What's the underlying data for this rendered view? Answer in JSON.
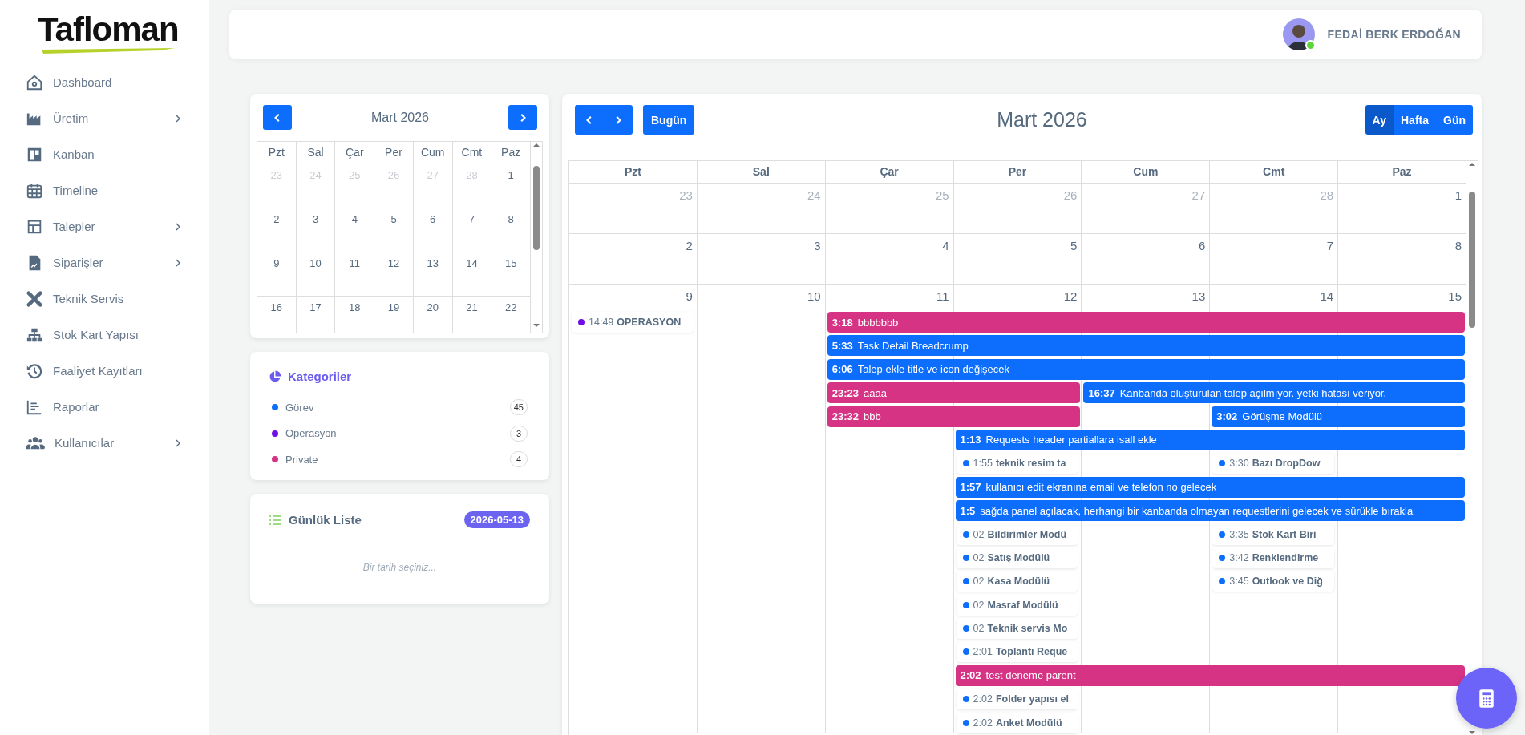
{
  "sidebar": {
    "logo": "Tafloman",
    "items": [
      {
        "label": "Dashboard",
        "has_submenu": false
      },
      {
        "label": "Üretim",
        "has_submenu": true
      },
      {
        "label": "Kanban",
        "has_submenu": false
      },
      {
        "label": "Timeline",
        "has_submenu": false
      },
      {
        "label": "Talepler",
        "has_submenu": true
      },
      {
        "label": "Siparişler",
        "has_submenu": true
      },
      {
        "label": "Teknik Servis",
        "has_submenu": false
      },
      {
        "label": "Stok Kart Yapısı",
        "has_submenu": false
      },
      {
        "label": "Faaliyet Kayıtları",
        "has_submenu": false
      },
      {
        "label": "Raporlar",
        "has_submenu": false
      },
      {
        "label": "Kullanıcılar",
        "has_submenu": true
      }
    ]
  },
  "header": {
    "user_name": "FEDAİ BERK ERDOĞAN",
    "online": true
  },
  "mini_calendar": {
    "title": "Mart 2026",
    "weekdays": [
      "Pzt",
      "Sal",
      "Çar",
      "Per",
      "Cum",
      "Cmt",
      "Paz"
    ],
    "weeks": [
      [
        {
          "day": "23",
          "muted": true
        },
        {
          "day": "24",
          "muted": true
        },
        {
          "day": "25",
          "muted": true
        },
        {
          "day": "26",
          "muted": true
        },
        {
          "day": "27",
          "muted": true
        },
        {
          "day": "28",
          "muted": true
        },
        {
          "day": "1",
          "muted": false
        }
      ],
      [
        {
          "day": "2",
          "muted": false
        },
        {
          "day": "3",
          "muted": false
        },
        {
          "day": "4",
          "muted": false
        },
        {
          "day": "5",
          "muted": false
        },
        {
          "day": "6",
          "muted": false
        },
        {
          "day": "7",
          "muted": false
        },
        {
          "day": "8",
          "muted": false
        }
      ],
      [
        {
          "day": "9",
          "muted": false
        },
        {
          "day": "10",
          "muted": false
        },
        {
          "day": "11",
          "muted": false
        },
        {
          "day": "12",
          "muted": false
        },
        {
          "day": "13",
          "muted": false
        },
        {
          "day": "14",
          "muted": false
        },
        {
          "day": "15",
          "muted": false
        }
      ],
      [
        {
          "day": "16",
          "muted": false
        },
        {
          "day": "17",
          "muted": false
        },
        {
          "day": "18",
          "muted": false
        },
        {
          "day": "19",
          "muted": false
        },
        {
          "day": "20",
          "muted": false
        },
        {
          "day": "21",
          "muted": false
        },
        {
          "day": "22",
          "muted": false
        }
      ]
    ]
  },
  "categories": {
    "title": "Kategoriler",
    "items": [
      {
        "label": "Görev",
        "count": "45",
        "color": "#0d6efd"
      },
      {
        "label": "Operasyon",
        "count": "3",
        "color": "#6f0fe6"
      },
      {
        "label": "Private",
        "count": "4",
        "color": "#d63384"
      }
    ]
  },
  "daily_list": {
    "title": "Günlük Liste",
    "date": "2026-05-13",
    "empty_text": "Bir tarih seçiniz..."
  },
  "calendar": {
    "title": "Mart 2026",
    "today_button": "Bugün",
    "views": [
      {
        "label": "Ay",
        "selected": true
      },
      {
        "label": "Hafta",
        "selected": false
      },
      {
        "label": "Gün",
        "selected": false
      }
    ],
    "weekdays": [
      "Pzt",
      "Sal",
      "Çar",
      "Per",
      "Cum",
      "Cmt",
      "Paz"
    ],
    "weeks": [
      {
        "days": [
          {
            "day": "23",
            "muted": true
          },
          {
            "day": "24",
            "muted": true
          },
          {
            "day": "25",
            "muted": true
          },
          {
            "day": "26",
            "muted": true
          },
          {
            "day": "27",
            "muted": true
          },
          {
            "day": "28",
            "muted": true
          },
          {
            "day": "1",
            "muted": false
          }
        ]
      },
      {
        "days": [
          {
            "day": "2",
            "muted": false
          },
          {
            "day": "3",
            "muted": false
          },
          {
            "day": "4",
            "muted": false
          },
          {
            "day": "5",
            "muted": false
          },
          {
            "day": "6",
            "muted": false
          },
          {
            "day": "7",
            "muted": false
          },
          {
            "day": "8",
            "muted": false
          }
        ]
      },
      {
        "days": [
          {
            "day": "9",
            "muted": false
          },
          {
            "day": "10",
            "muted": false
          },
          {
            "day": "11",
            "muted": false
          },
          {
            "day": "12",
            "muted": false
          },
          {
            "day": "13",
            "muted": false
          },
          {
            "day": "14",
            "muted": false
          },
          {
            "day": "15",
            "muted": false
          }
        ],
        "lanes": [
          [
            {
              "kind": "dot",
              "time": "14:49",
              "title": "OPERASYON",
              "color": "#6f0fe6"
            },
            {
              "kind": "empty"
            },
            {
              "kind": "bar",
              "time": "3:18",
              "title": "bbbbbbb",
              "color": "#d63384"
            },
            {
              "kind": "more"
            },
            {
              "kind": "more"
            },
            {
              "kind": "more"
            },
            {
              "kind": "more"
            }
          ],
          [
            {
              "kind": "empty"
            },
            {
              "kind": "empty"
            },
            {
              "kind": "bar",
              "time": "5:33",
              "title": "Task Detail Breadcrump",
              "color": "#0d6efd"
            },
            {
              "kind": "more"
            },
            {
              "kind": "more"
            },
            {
              "kind": "more"
            },
            {
              "kind": "more"
            }
          ],
          [
            {
              "kind": "empty"
            },
            {
              "kind": "empty"
            },
            {
              "kind": "bar",
              "time": "6:06",
              "title": "Talep ekle title ve icon değişecek",
              "color": "#0d6efd"
            },
            {
              "kind": "more"
            },
            {
              "kind": "more"
            },
            {
              "kind": "more"
            },
            {
              "kind": "more"
            }
          ],
          [
            {
              "kind": "empty"
            },
            {
              "kind": "empty"
            },
            {
              "kind": "bar",
              "time": "23:23",
              "title": "aaaa",
              "color": "#d63384"
            },
            {
              "kind": "more"
            },
            {
              "kind": "bar",
              "time": "16:37",
              "title": "Kanbanda oluşturulan talep açılmıyor. yetki hatası veriyor.",
              "color": "#0d6efd"
            },
            {
              "kind": "more"
            },
            {
              "kind": "more"
            }
          ],
          [
            {
              "kind": "empty"
            },
            {
              "kind": "empty"
            },
            {
              "kind": "bar",
              "time": "23:32",
              "title": "bbb",
              "color": "#d63384"
            },
            {
              "kind": "more"
            },
            {
              "kind": "empty"
            },
            {
              "kind": "bar",
              "time": "3:02",
              "title": "Görüşme Modülü",
              "color": "#0d6efd"
            },
            {
              "kind": "more"
            }
          ],
          [
            {
              "kind": "empty"
            },
            {
              "kind": "empty"
            },
            {
              "kind": "empty"
            },
            {
              "kind": "bar",
              "time": "1:13",
              "title": "Requests header partiallara isall ekle",
              "color": "#0d6efd"
            },
            {
              "kind": "more"
            },
            {
              "kind": "more"
            },
            {
              "kind": "more"
            }
          ],
          [
            {
              "kind": "empty"
            },
            {
              "kind": "empty"
            },
            {
              "kind": "empty"
            },
            {
              "kind": "dot",
              "time": "1:55",
              "title": "teknik resim ta",
              "color": "#0d6efd"
            },
            {
              "kind": "empty"
            },
            {
              "kind": "dot",
              "time": "3:30",
              "title": "Bazı DropDow",
              "color": "#0d6efd"
            }
          ],
          [
            {
              "kind": "empty"
            },
            {
              "kind": "empty"
            },
            {
              "kind": "empty"
            },
            {
              "kind": "bar",
              "time": "1:57",
              "title": "kullanıcı edit ekranına email ve telefon no gelecek",
              "color": "#0d6efd"
            },
            {
              "kind": "more"
            },
            {
              "kind": "more"
            },
            {
              "kind": "more"
            }
          ],
          [
            {
              "kind": "empty"
            },
            {
              "kind": "empty"
            },
            {
              "kind": "empty"
            },
            {
              "kind": "bar",
              "time": "1:5",
              "title": "sağda panel açılacak, herhangi bir kanbanda olmayan requestlerini gelecek ve sürükle bırakla",
              "color": "#0d6efd"
            },
            {
              "kind": "more"
            },
            {
              "kind": "more"
            },
            {
              "kind": "more"
            }
          ],
          [
            {
              "kind": "empty"
            },
            {
              "kind": "empty"
            },
            {
              "kind": "empty"
            },
            {
              "kind": "dot",
              "time": "02",
              "title": "Bildirimler Modü",
              "color": "#0d6efd"
            },
            {
              "kind": "empty"
            },
            {
              "kind": "dot",
              "time": "3:35",
              "title": "Stok Kart Biri",
              "color": "#0d6efd"
            }
          ],
          [
            {
              "kind": "empty"
            },
            {
              "kind": "empty"
            },
            {
              "kind": "empty"
            },
            {
              "kind": "dot",
              "time": "02",
              "title": "Satış Modülü",
              "color": "#0d6efd"
            },
            {
              "kind": "empty"
            },
            {
              "kind": "dot",
              "time": "3:42",
              "title": "Renklendirme",
              "color": "#0d6efd"
            }
          ],
          [
            {
              "kind": "empty"
            },
            {
              "kind": "empty"
            },
            {
              "kind": "empty"
            },
            {
              "kind": "dot",
              "time": "02",
              "title": "Kasa Modülü",
              "color": "#0d6efd"
            },
            {
              "kind": "empty"
            },
            {
              "kind": "dot",
              "time": "3:45",
              "title": "Outlook ve Diğ",
              "color": "#0d6efd"
            }
          ],
          [
            {
              "kind": "empty"
            },
            {
              "kind": "empty"
            },
            {
              "kind": "empty"
            },
            {
              "kind": "dot",
              "time": "02",
              "title": "Masraf Modülü",
              "color": "#0d6efd"
            }
          ],
          [
            {
              "kind": "empty"
            },
            {
              "kind": "empty"
            },
            {
              "kind": "empty"
            },
            {
              "kind": "dot",
              "time": "02",
              "title": "Teknik servis Mo",
              "color": "#0d6efd"
            }
          ],
          [
            {
              "kind": "empty"
            },
            {
              "kind": "empty"
            },
            {
              "kind": "empty"
            },
            {
              "kind": "dot",
              "time": "2:01",
              "title": "Toplantı Reque",
              "color": "#0d6efd"
            }
          ],
          [
            {
              "kind": "empty"
            },
            {
              "kind": "empty"
            },
            {
              "kind": "empty"
            },
            {
              "kind": "bar",
              "time": "2:02",
              "title": "test deneme parent",
              "color": "#d63384"
            },
            {
              "kind": "more"
            },
            {
              "kind": "more"
            },
            {
              "kind": "more"
            }
          ],
          [
            {
              "kind": "empty"
            },
            {
              "kind": "empty"
            },
            {
              "kind": "empty"
            },
            {
              "kind": "dot",
              "time": "2:02",
              "title": "Folder yapısı el",
              "color": "#0d6efd"
            }
          ],
          [
            {
              "kind": "empty"
            },
            {
              "kind": "empty"
            },
            {
              "kind": "empty"
            },
            {
              "kind": "dot",
              "time": "2:02",
              "title": "Anket Modülü",
              "color": "#0d6efd"
            }
          ]
        ]
      }
    ]
  }
}
